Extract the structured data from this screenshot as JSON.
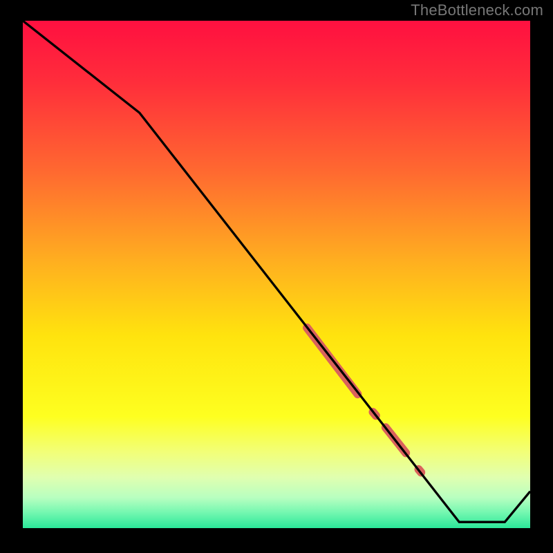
{
  "watermark": "TheBottleneck.com",
  "chart_data": {
    "type": "line",
    "title": "",
    "xlabel": "",
    "ylabel": "",
    "xlim": [
      0,
      100
    ],
    "ylim": [
      0,
      100
    ],
    "grid": false,
    "series": [
      {
        "name": "curve",
        "color": "#000000",
        "points": [
          {
            "x": 0,
            "y": 100
          },
          {
            "x": 23,
            "y": 82
          },
          {
            "x": 86,
            "y": 2
          },
          {
            "x": 95,
            "y": 2
          },
          {
            "x": 100,
            "y": 8
          }
        ]
      }
    ],
    "highlights": [
      {
        "name": "segment-a",
        "color": "#d9625c",
        "width": 12,
        "cap": "round",
        "start": {
          "x": 56,
          "y": 40
        },
        "end": {
          "x": 66,
          "y": 27
        }
      },
      {
        "name": "dot-b",
        "color": "#d9625c",
        "width": 12,
        "cap": "round",
        "start": {
          "x": 69,
          "y": 23.5
        },
        "end": {
          "x": 69.6,
          "y": 22.8
        }
      },
      {
        "name": "segment-c",
        "color": "#d9625c",
        "width": 12,
        "cap": "round",
        "start": {
          "x": 71.5,
          "y": 20.5
        },
        "end": {
          "x": 75.5,
          "y": 15.5
        }
      },
      {
        "name": "dot-d",
        "color": "#d9625c",
        "width": 12,
        "cap": "round",
        "start": {
          "x": 78,
          "y": 12.3
        },
        "end": {
          "x": 78.5,
          "y": 11.7
        }
      }
    ],
    "gradient_stops": [
      {
        "offset": 0,
        "color": "#ff1040"
      },
      {
        "offset": 0.12,
        "color": "#ff2d3b"
      },
      {
        "offset": 0.3,
        "color": "#ff6a30"
      },
      {
        "offset": 0.48,
        "color": "#ffb11f"
      },
      {
        "offset": 0.62,
        "color": "#ffe30e"
      },
      {
        "offset": 0.78,
        "color": "#feff20"
      },
      {
        "offset": 0.85,
        "color": "#f2ff78"
      },
      {
        "offset": 0.9,
        "color": "#e0ffb0"
      },
      {
        "offset": 0.94,
        "color": "#b8ffc0"
      },
      {
        "offset": 0.97,
        "color": "#72f7b0"
      },
      {
        "offset": 1.0,
        "color": "#2ae89a"
      }
    ]
  }
}
